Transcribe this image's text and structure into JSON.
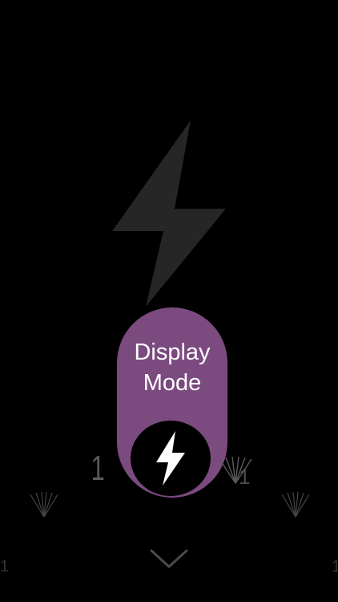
{
  "display_mode": {
    "label": "Display Mode",
    "selected_icon": "lightning-bolt-icon",
    "accent_color": "#7b4a7f"
  },
  "hero": {
    "icon": "lightning-bolt-icon",
    "color": "#262626"
  },
  "mode_wheel": {
    "left_item": "1",
    "right_item": "1",
    "far_left_item": "1",
    "far_right_item": "1"
  },
  "expand": {
    "icon": "chevron-down-icon"
  }
}
